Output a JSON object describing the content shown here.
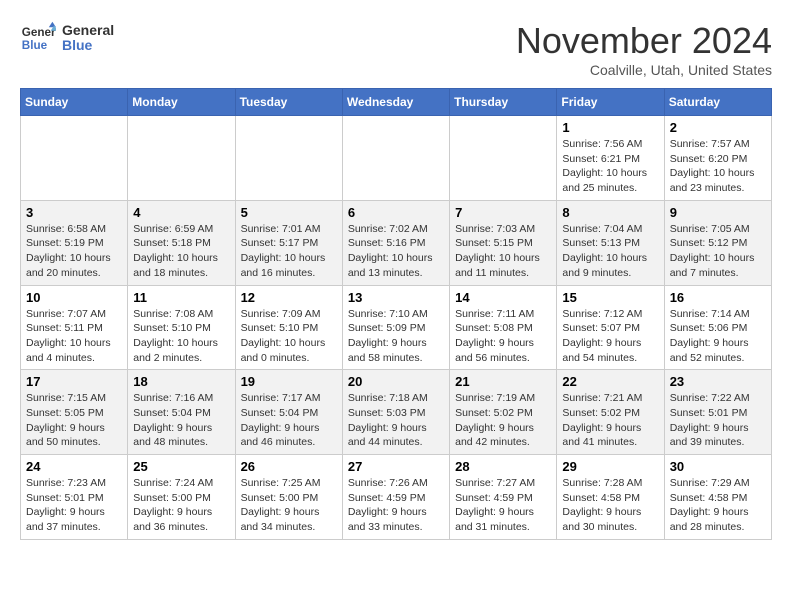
{
  "header": {
    "logo_line1": "General",
    "logo_line2": "Blue",
    "month_title": "November 2024",
    "location": "Coalville, Utah, United States"
  },
  "weekdays": [
    "Sunday",
    "Monday",
    "Tuesday",
    "Wednesday",
    "Thursday",
    "Friday",
    "Saturday"
  ],
  "weeks": [
    [
      {
        "day": "",
        "info": ""
      },
      {
        "day": "",
        "info": ""
      },
      {
        "day": "",
        "info": ""
      },
      {
        "day": "",
        "info": ""
      },
      {
        "day": "",
        "info": ""
      },
      {
        "day": "1",
        "info": "Sunrise: 7:56 AM\nSunset: 6:21 PM\nDaylight: 10 hours\nand 25 minutes."
      },
      {
        "day": "2",
        "info": "Sunrise: 7:57 AM\nSunset: 6:20 PM\nDaylight: 10 hours\nand 23 minutes."
      }
    ],
    [
      {
        "day": "3",
        "info": "Sunrise: 6:58 AM\nSunset: 5:19 PM\nDaylight: 10 hours\nand 20 minutes."
      },
      {
        "day": "4",
        "info": "Sunrise: 6:59 AM\nSunset: 5:18 PM\nDaylight: 10 hours\nand 18 minutes."
      },
      {
        "day": "5",
        "info": "Sunrise: 7:01 AM\nSunset: 5:17 PM\nDaylight: 10 hours\nand 16 minutes."
      },
      {
        "day": "6",
        "info": "Sunrise: 7:02 AM\nSunset: 5:16 PM\nDaylight: 10 hours\nand 13 minutes."
      },
      {
        "day": "7",
        "info": "Sunrise: 7:03 AM\nSunset: 5:15 PM\nDaylight: 10 hours\nand 11 minutes."
      },
      {
        "day": "8",
        "info": "Sunrise: 7:04 AM\nSunset: 5:13 PM\nDaylight: 10 hours\nand 9 minutes."
      },
      {
        "day": "9",
        "info": "Sunrise: 7:05 AM\nSunset: 5:12 PM\nDaylight: 10 hours\nand 7 minutes."
      }
    ],
    [
      {
        "day": "10",
        "info": "Sunrise: 7:07 AM\nSunset: 5:11 PM\nDaylight: 10 hours\nand 4 minutes."
      },
      {
        "day": "11",
        "info": "Sunrise: 7:08 AM\nSunset: 5:10 PM\nDaylight: 10 hours\nand 2 minutes."
      },
      {
        "day": "12",
        "info": "Sunrise: 7:09 AM\nSunset: 5:10 PM\nDaylight: 10 hours\nand 0 minutes."
      },
      {
        "day": "13",
        "info": "Sunrise: 7:10 AM\nSunset: 5:09 PM\nDaylight: 9 hours\nand 58 minutes."
      },
      {
        "day": "14",
        "info": "Sunrise: 7:11 AM\nSunset: 5:08 PM\nDaylight: 9 hours\nand 56 minutes."
      },
      {
        "day": "15",
        "info": "Sunrise: 7:12 AM\nSunset: 5:07 PM\nDaylight: 9 hours\nand 54 minutes."
      },
      {
        "day": "16",
        "info": "Sunrise: 7:14 AM\nSunset: 5:06 PM\nDaylight: 9 hours\nand 52 minutes."
      }
    ],
    [
      {
        "day": "17",
        "info": "Sunrise: 7:15 AM\nSunset: 5:05 PM\nDaylight: 9 hours\nand 50 minutes."
      },
      {
        "day": "18",
        "info": "Sunrise: 7:16 AM\nSunset: 5:04 PM\nDaylight: 9 hours\nand 48 minutes."
      },
      {
        "day": "19",
        "info": "Sunrise: 7:17 AM\nSunset: 5:04 PM\nDaylight: 9 hours\nand 46 minutes."
      },
      {
        "day": "20",
        "info": "Sunrise: 7:18 AM\nSunset: 5:03 PM\nDaylight: 9 hours\nand 44 minutes."
      },
      {
        "day": "21",
        "info": "Sunrise: 7:19 AM\nSunset: 5:02 PM\nDaylight: 9 hours\nand 42 minutes."
      },
      {
        "day": "22",
        "info": "Sunrise: 7:21 AM\nSunset: 5:02 PM\nDaylight: 9 hours\nand 41 minutes."
      },
      {
        "day": "23",
        "info": "Sunrise: 7:22 AM\nSunset: 5:01 PM\nDaylight: 9 hours\nand 39 minutes."
      }
    ],
    [
      {
        "day": "24",
        "info": "Sunrise: 7:23 AM\nSunset: 5:01 PM\nDaylight: 9 hours\nand 37 minutes."
      },
      {
        "day": "25",
        "info": "Sunrise: 7:24 AM\nSunset: 5:00 PM\nDaylight: 9 hours\nand 36 minutes."
      },
      {
        "day": "26",
        "info": "Sunrise: 7:25 AM\nSunset: 5:00 PM\nDaylight: 9 hours\nand 34 minutes."
      },
      {
        "day": "27",
        "info": "Sunrise: 7:26 AM\nSunset: 4:59 PM\nDaylight: 9 hours\nand 33 minutes."
      },
      {
        "day": "28",
        "info": "Sunrise: 7:27 AM\nSunset: 4:59 PM\nDaylight: 9 hours\nand 31 minutes."
      },
      {
        "day": "29",
        "info": "Sunrise: 7:28 AM\nSunset: 4:58 PM\nDaylight: 9 hours\nand 30 minutes."
      },
      {
        "day": "30",
        "info": "Sunrise: 7:29 AM\nSunset: 4:58 PM\nDaylight: 9 hours\nand 28 minutes."
      }
    ]
  ]
}
